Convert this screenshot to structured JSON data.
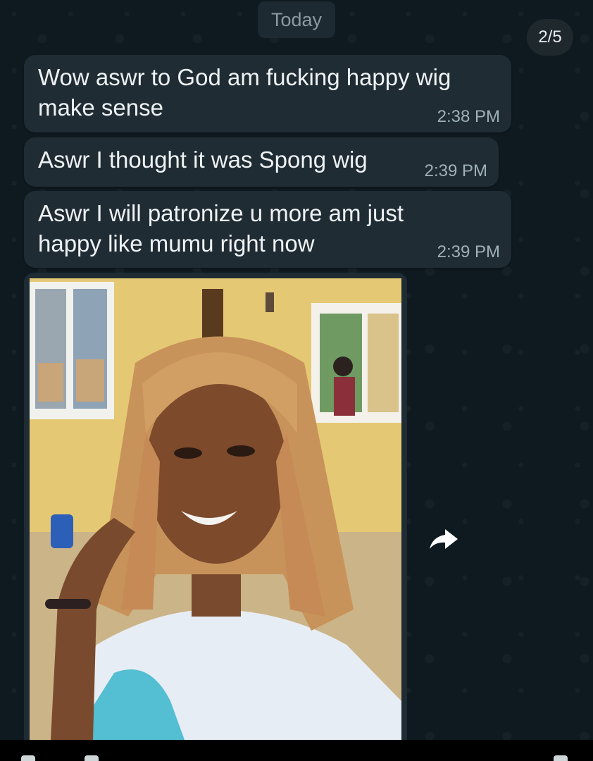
{
  "chat": {
    "date_separator": "Today",
    "page_counter": "2/5",
    "messages": [
      {
        "text": "Wow aswr to God am fucking happy wig\nmake sense",
        "time": "2:38 PM"
      },
      {
        "text": "Aswr I thought it was Spong wig",
        "time": "2:39 PM"
      },
      {
        "text": "Aswr I will patronize u more am just\nhappy like mumu right now",
        "time": "2:39 PM"
      }
    ],
    "photo_message": {
      "kind": "image",
      "forward_icon": "forward-arrow-icon"
    }
  },
  "colors": {
    "background": "#0e1a20",
    "bubble": "#202c33",
    "text": "#eef2f4",
    "timestamp": "#9fb0b8"
  }
}
